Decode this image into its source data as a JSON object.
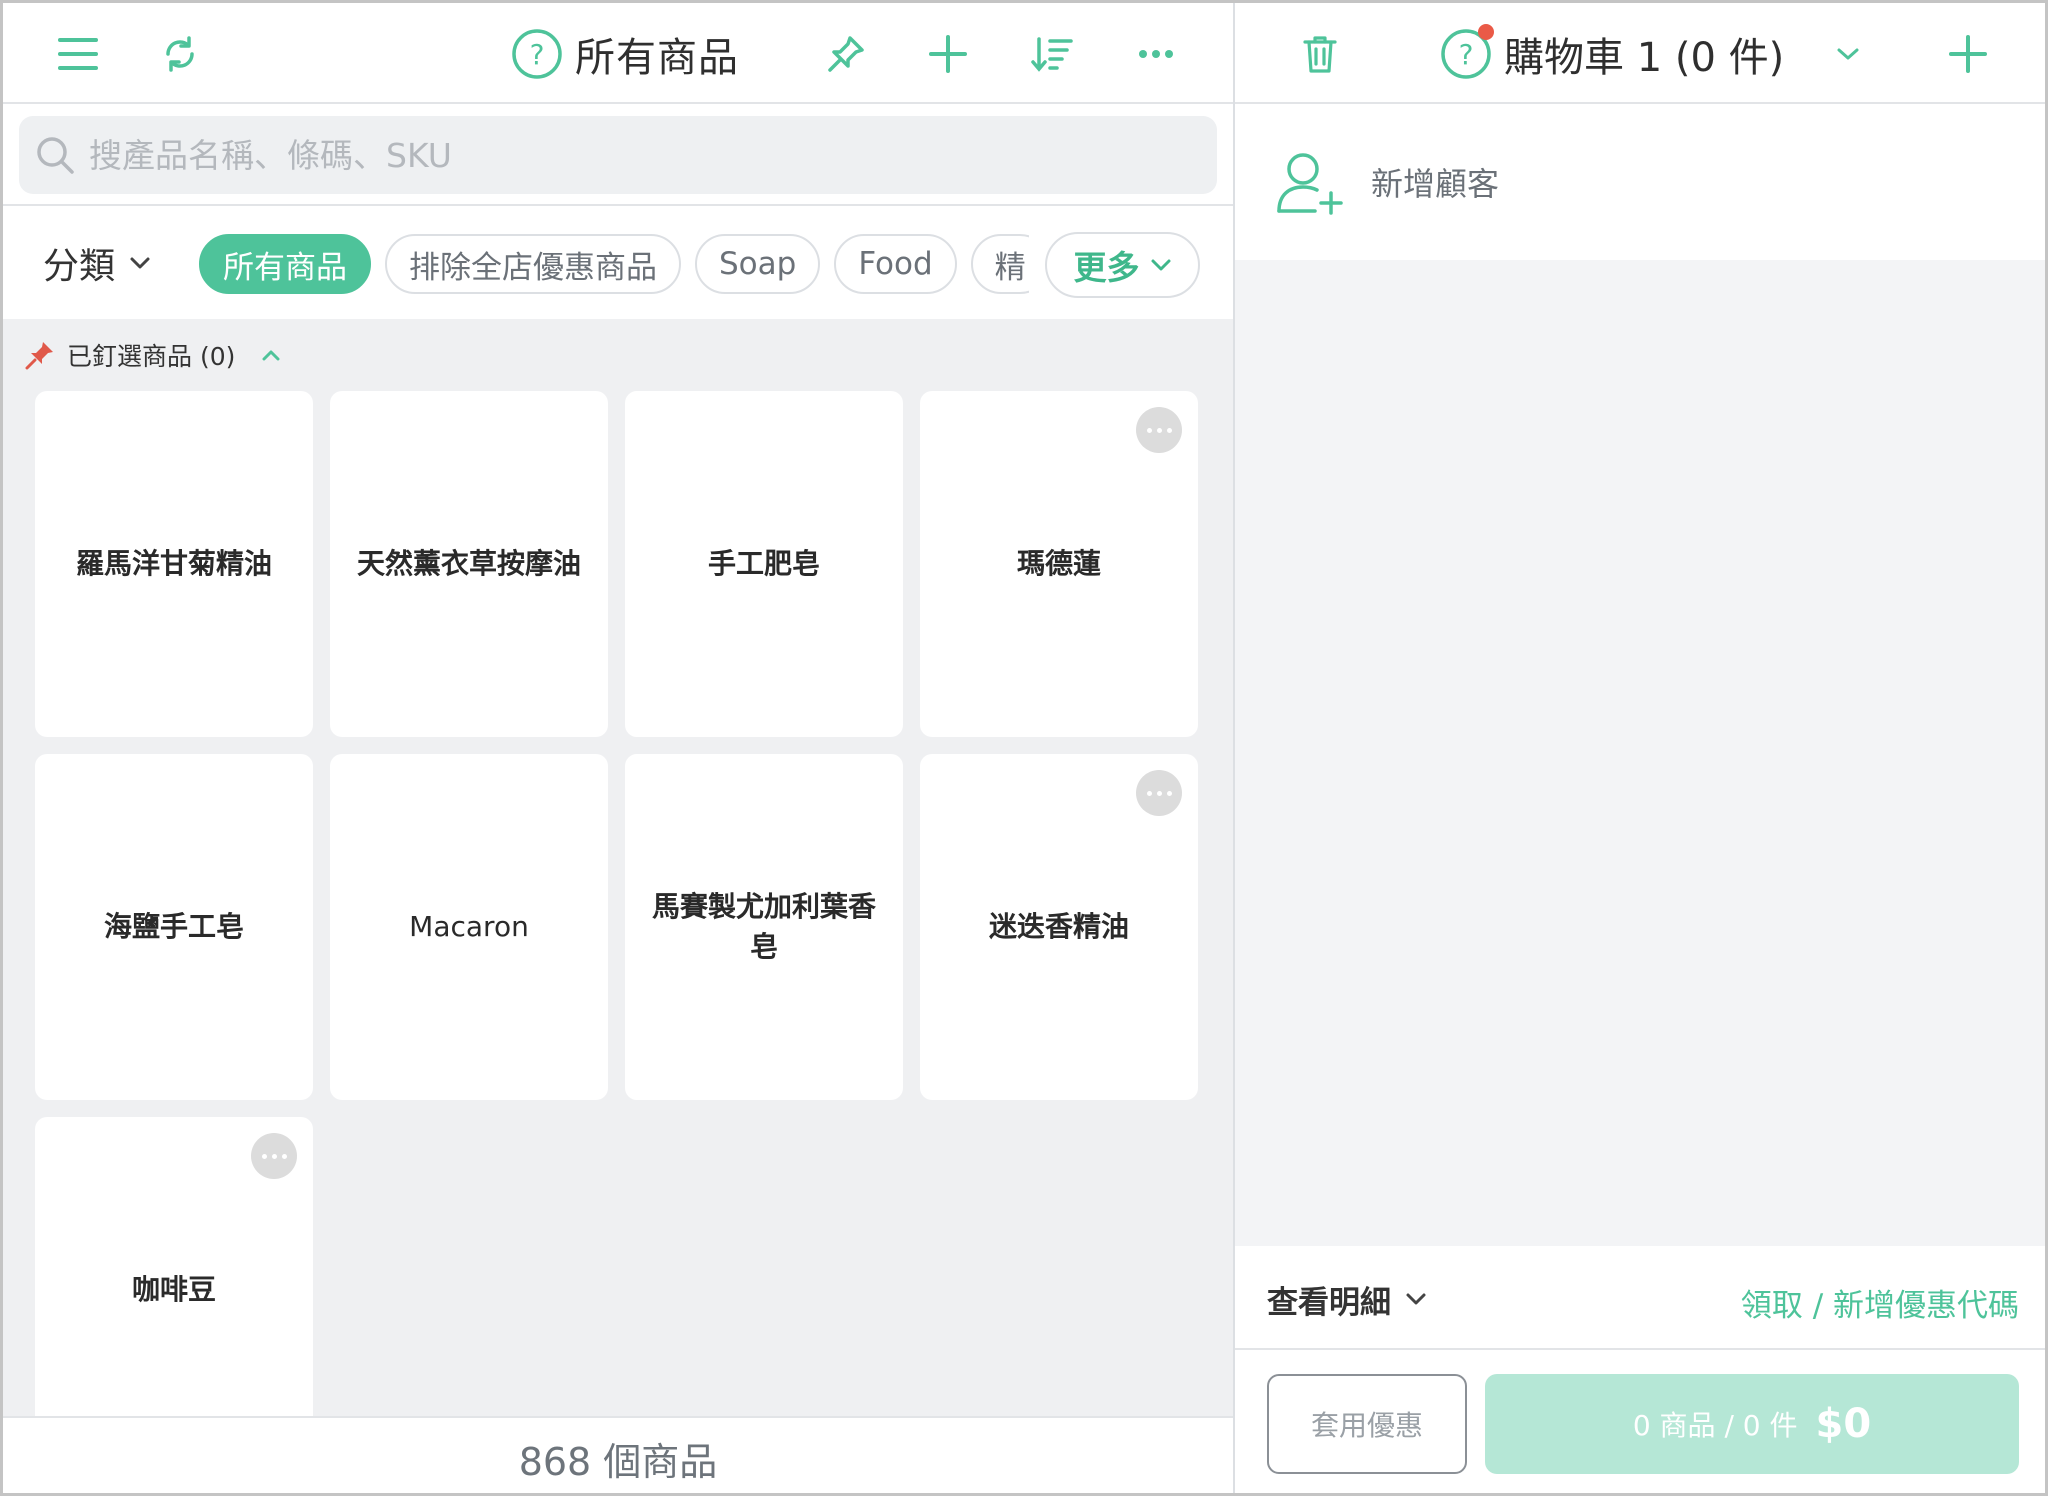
{
  "colors": {
    "accent": "#4ec39a",
    "pin": "#e0594a",
    "badge": "#ea5a47"
  },
  "left": {
    "title": "所有商品",
    "search": {
      "placeholder": "搜產品名稱、條碼、SKU",
      "value": ""
    },
    "category": {
      "label": "分類",
      "chips": [
        {
          "label": "所有商品",
          "active": true
        },
        {
          "label": "排除全店優惠商品",
          "active": false
        },
        {
          "label": "Soap",
          "active": false
        },
        {
          "label": "Food",
          "active": false
        },
        {
          "label": "精",
          "active": false
        }
      ],
      "more_label": "更多"
    },
    "pinned": {
      "label": "已釘選商品 (0)"
    },
    "products": [
      {
        "name": "羅馬洋甘菊精油",
        "has_menu": false
      },
      {
        "name": "天然薰衣草按摩油",
        "has_menu": false
      },
      {
        "name": "手工肥皂",
        "has_menu": false
      },
      {
        "name": "瑪德蓮",
        "has_menu": true
      },
      {
        "name": "海鹽手工皂",
        "has_menu": false
      },
      {
        "name": "Macaron",
        "has_menu": false
      },
      {
        "name": "馬賽製尤加利葉香皂",
        "has_menu": false
      },
      {
        "name": "迷迭香精油",
        "has_menu": true
      },
      {
        "name": "咖啡豆",
        "has_menu": true
      }
    ],
    "count_label": "868 個商品"
  },
  "right": {
    "cart_title": "購物車 1 (0 件)",
    "add_customer_label": "新增顧客",
    "details_label": "查看明細",
    "coupon_link": "領取 / 新增優惠代碼",
    "apply_label": "套用優惠",
    "checkout_summary": "0 商品 / 0 件",
    "checkout_amount": "$0"
  }
}
